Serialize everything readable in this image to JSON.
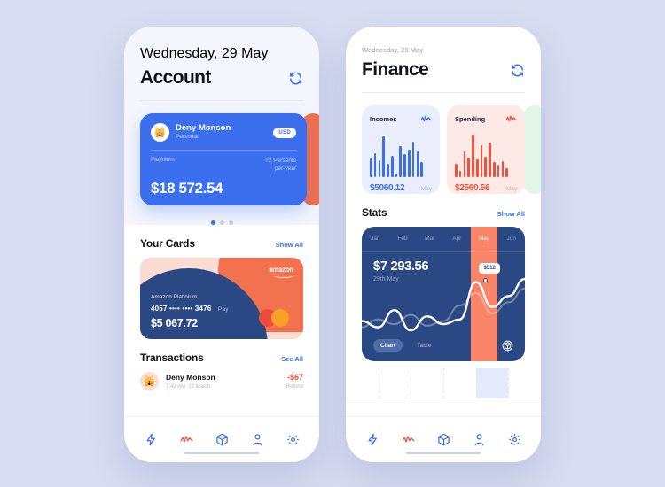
{
  "theme": {
    "bg": "#d7dcf0",
    "blue": "#3b6fee",
    "navy": "#2a4884",
    "red": "#f0513c",
    "orange": "#fa8468",
    "peach": "#fbdcd3",
    "mint": "#e1f6e6"
  },
  "left": {
    "date": "Wednesday, 29 May",
    "title": "Account",
    "sync_icon": "refresh-icon",
    "account_card": {
      "avatar": "avatar-emoji",
      "name": "Deny Monson",
      "subtitle": "Personal",
      "currency": "USD",
      "tier": "Platinium",
      "rate_line1": "+2 Persents",
      "rate_line2": "per-year",
      "balance": "$18 572.54"
    },
    "pager": {
      "count": 3,
      "active": 0
    },
    "cards_section": {
      "title": "Your Cards",
      "link": "Show All"
    },
    "amazon_card": {
      "brand": "amazon",
      "tier": "Amazon Platinium",
      "number": "4057 •••• •••• 3476",
      "pay": " Pay",
      "amount": "$5 067.72",
      "network_icon": "mastercard-icon"
    },
    "transactions_section": {
      "title": "Transactions",
      "link": "See All"
    },
    "transactions": [
      {
        "avatar": "avatar-emoji",
        "name": "Deny Monson",
        "time": "7:42 AM",
        "date": "12 March",
        "amount": "-$67",
        "tag": "Refund"
      }
    ],
    "tabs": [
      {
        "icon": "bolt-icon",
        "active": false
      },
      {
        "icon": "activity-icon",
        "active": true
      },
      {
        "icon": "cube-icon",
        "active": false
      },
      {
        "icon": "person-icon",
        "active": false
      },
      {
        "icon": "gear-icon",
        "active": false
      }
    ]
  },
  "right": {
    "date": "Wednesday, 29 May",
    "title": "Finance",
    "sync_icon": "refresh-icon",
    "incomes": {
      "label": "Incomes",
      "icon": "activity-icon",
      "amount": "$5060.12",
      "month": "May"
    },
    "spending": {
      "label": "Spending",
      "icon": "activity-icon",
      "amount": "$2560.56",
      "month": "May"
    },
    "stats_section": {
      "title": "Stats",
      "link": "Show All"
    },
    "stats": {
      "amount": "$7 293.56",
      "date": "29th May",
      "tooltip": "$512",
      "toggle": {
        "chart": "Chart",
        "table": "Table",
        "active": "Chart"
      },
      "cube_icon": "cube-3d-icon"
    },
    "tabs": [
      {
        "icon": "bolt-icon",
        "active": false
      },
      {
        "icon": "activity-icon",
        "active": true
      },
      {
        "icon": "cube-icon",
        "active": false
      },
      {
        "icon": "person-icon",
        "active": false
      },
      {
        "icon": "gear-icon",
        "active": false
      }
    ]
  },
  "chart_data": [
    {
      "type": "bar",
      "title": "Incomes",
      "categories": [
        "1",
        "2",
        "3",
        "4",
        "5",
        "6",
        "7",
        "8",
        "9",
        "10",
        "11",
        "12",
        "13"
      ],
      "values": [
        42,
        55,
        38,
        92,
        30,
        48,
        8,
        70,
        52,
        62,
        80,
        58,
        34
      ],
      "ylim": [
        0,
        100
      ],
      "color": "#3b6fee",
      "label": "$5060.12",
      "period": "May"
    },
    {
      "type": "bar",
      "title": "Spending",
      "categories": [
        "1",
        "2",
        "3",
        "4",
        "5",
        "6",
        "7",
        "8",
        "9",
        "10",
        "11",
        "12",
        "13"
      ],
      "values": [
        30,
        14,
        58,
        44,
        96,
        40,
        72,
        46,
        78,
        34,
        28,
        36,
        20
      ],
      "ylim": [
        0,
        100
      ],
      "color": "#f0513c",
      "label": "$2560.56",
      "period": "May"
    },
    {
      "type": "line",
      "title": "Stats",
      "categories": [
        "Jan",
        "Feb",
        "Mar",
        "Apr",
        "May",
        "Jun"
      ],
      "highlight": "May",
      "annotation": {
        "label": "$512",
        "at": "May"
      },
      "series": [
        {
          "name": "primary",
          "color": "#ffffff",
          "values": [
            38,
            30,
            52,
            26,
            44,
            34,
            40,
            88,
            56,
            70,
            92
          ]
        },
        {
          "name": "secondary",
          "color": "rgba(255,255,255,0.34)",
          "values": [
            30,
            40,
            34,
            46,
            32,
            38,
            58,
            74,
            48,
            62,
            80
          ]
        }
      ],
      "ylim": [
        0,
        100
      ],
      "grid": false,
      "legend": false
    }
  ]
}
